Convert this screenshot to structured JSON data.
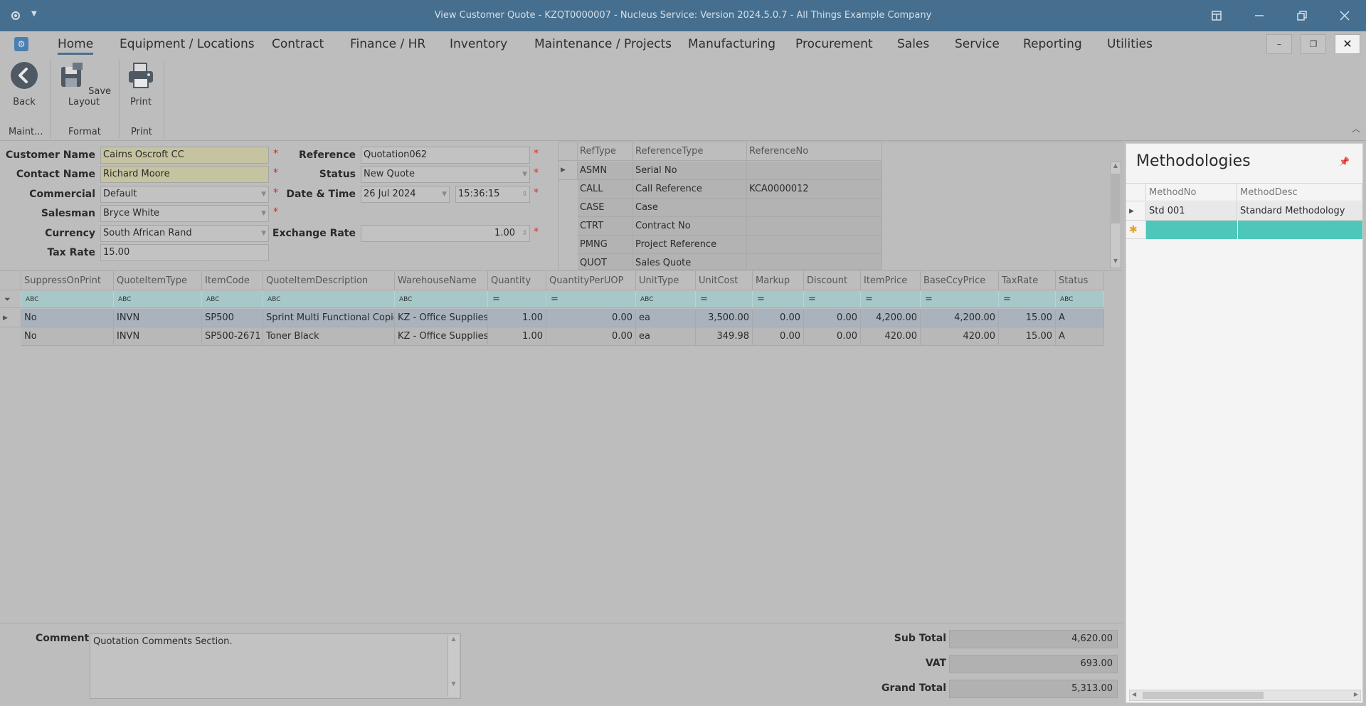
{
  "window": {
    "title": "View Customer Quote - KZQT0000007 - Nucleus Service: Version 2024.5.0.7 - All Things Example Company"
  },
  "menu": {
    "tabs": [
      "Home",
      "Equipment / Locations",
      "Contract",
      "Finance / HR",
      "Inventory",
      "Maintenance / Projects",
      "Manufacturing",
      "Procurement",
      "Sales",
      "Service",
      "Reporting",
      "Utilities"
    ],
    "active": "Home"
  },
  "ribbon": {
    "back_label": "Back",
    "save_layout_label": "Save Layout",
    "print_label": "Print",
    "groups": [
      "Maint...",
      "Format",
      "Print"
    ]
  },
  "header_form": {
    "customer_name": {
      "label": "Customer Name",
      "value": "Cairns Oscroft CC"
    },
    "contact_name": {
      "label": "Contact Name",
      "value": "Richard Moore"
    },
    "commercial": {
      "label": "Commercial",
      "value": "Default"
    },
    "salesman": {
      "label": "Salesman",
      "value": "Bryce White"
    },
    "currency": {
      "label": "Currency",
      "value": "South African Rand"
    },
    "tax_rate": {
      "label": "Tax Rate",
      "value": "15.00"
    },
    "reference": {
      "label": "Reference",
      "value": "Quotation062"
    },
    "status": {
      "label": "Status",
      "value": "New Quote"
    },
    "date_time": {
      "label": "Date & Time",
      "date": "26 Jul 2024",
      "time": "15:36:15"
    },
    "exchange_rate": {
      "label": "Exchange Rate",
      "value": "1.00"
    }
  },
  "reference_grid": {
    "columns": [
      "RefType",
      "ReferenceType",
      "ReferenceNo"
    ],
    "rows": [
      [
        "ASMN",
        "Serial No",
        ""
      ],
      [
        "CALL",
        "Call Reference",
        "KCA0000012"
      ],
      [
        "CASE",
        "Case",
        ""
      ],
      [
        "CTRT",
        "Contract No",
        ""
      ],
      [
        "PMNG",
        "Project Reference",
        ""
      ],
      [
        "QUOT",
        "Sales Quote",
        ""
      ]
    ]
  },
  "items_grid": {
    "columns": [
      "SuppressOnPrint",
      "QuoteItemType",
      "ItemCode",
      "QuoteItemDescription",
      "WarehouseName",
      "Quantity",
      "QuantityPerUOP",
      "UnitType",
      "UnitCost",
      "Markup",
      "Discount",
      "ItemPrice",
      "BaseCcyPrice",
      "TaxRate",
      "Status"
    ],
    "filter_glyphs": [
      "ABC",
      "ABC",
      "ABC",
      "ABC",
      "ABC",
      "=",
      "=",
      "ABC",
      "=",
      "=",
      "=",
      "=",
      "=",
      "=",
      "ABC"
    ],
    "rows": [
      [
        "No",
        "INVN",
        "SP500",
        "Sprint Multi Functional Copier",
        "KZ - Office Supplies",
        "1.00",
        "0.00",
        "ea",
        "3,500.00",
        "0.00",
        "0.00",
        "4,200.00",
        "4,200.00",
        "15.00",
        "A"
      ],
      [
        "No",
        "INVN",
        "SP500-2671",
        "Toner Black",
        "KZ - Office Supplies",
        "1.00",
        "0.00",
        "ea",
        "349.98",
        "0.00",
        "0.00",
        "420.00",
        "420.00",
        "15.00",
        "A"
      ]
    ]
  },
  "footer": {
    "comment_label": "Comment",
    "comment_value": "Quotation Comments Section.",
    "sub_total_label": "Sub Total",
    "sub_total": "4,620.00",
    "vat_label": "VAT",
    "vat": "693.00",
    "grand_total_label": "Grand Total",
    "grand_total": "5,313.00"
  },
  "methodologies": {
    "title": "Methodologies",
    "columns": [
      "MethodNo",
      "MethodDesc"
    ],
    "rows": [
      [
        "Std 001",
        "Standard Methodology"
      ]
    ]
  },
  "colors": {
    "titlebar": "#466f8f",
    "accent": "#4b6f90",
    "required_field": "#c6c3a0",
    "filter_row": "#a6c8c8",
    "new_row": "#4fc7b8"
  }
}
